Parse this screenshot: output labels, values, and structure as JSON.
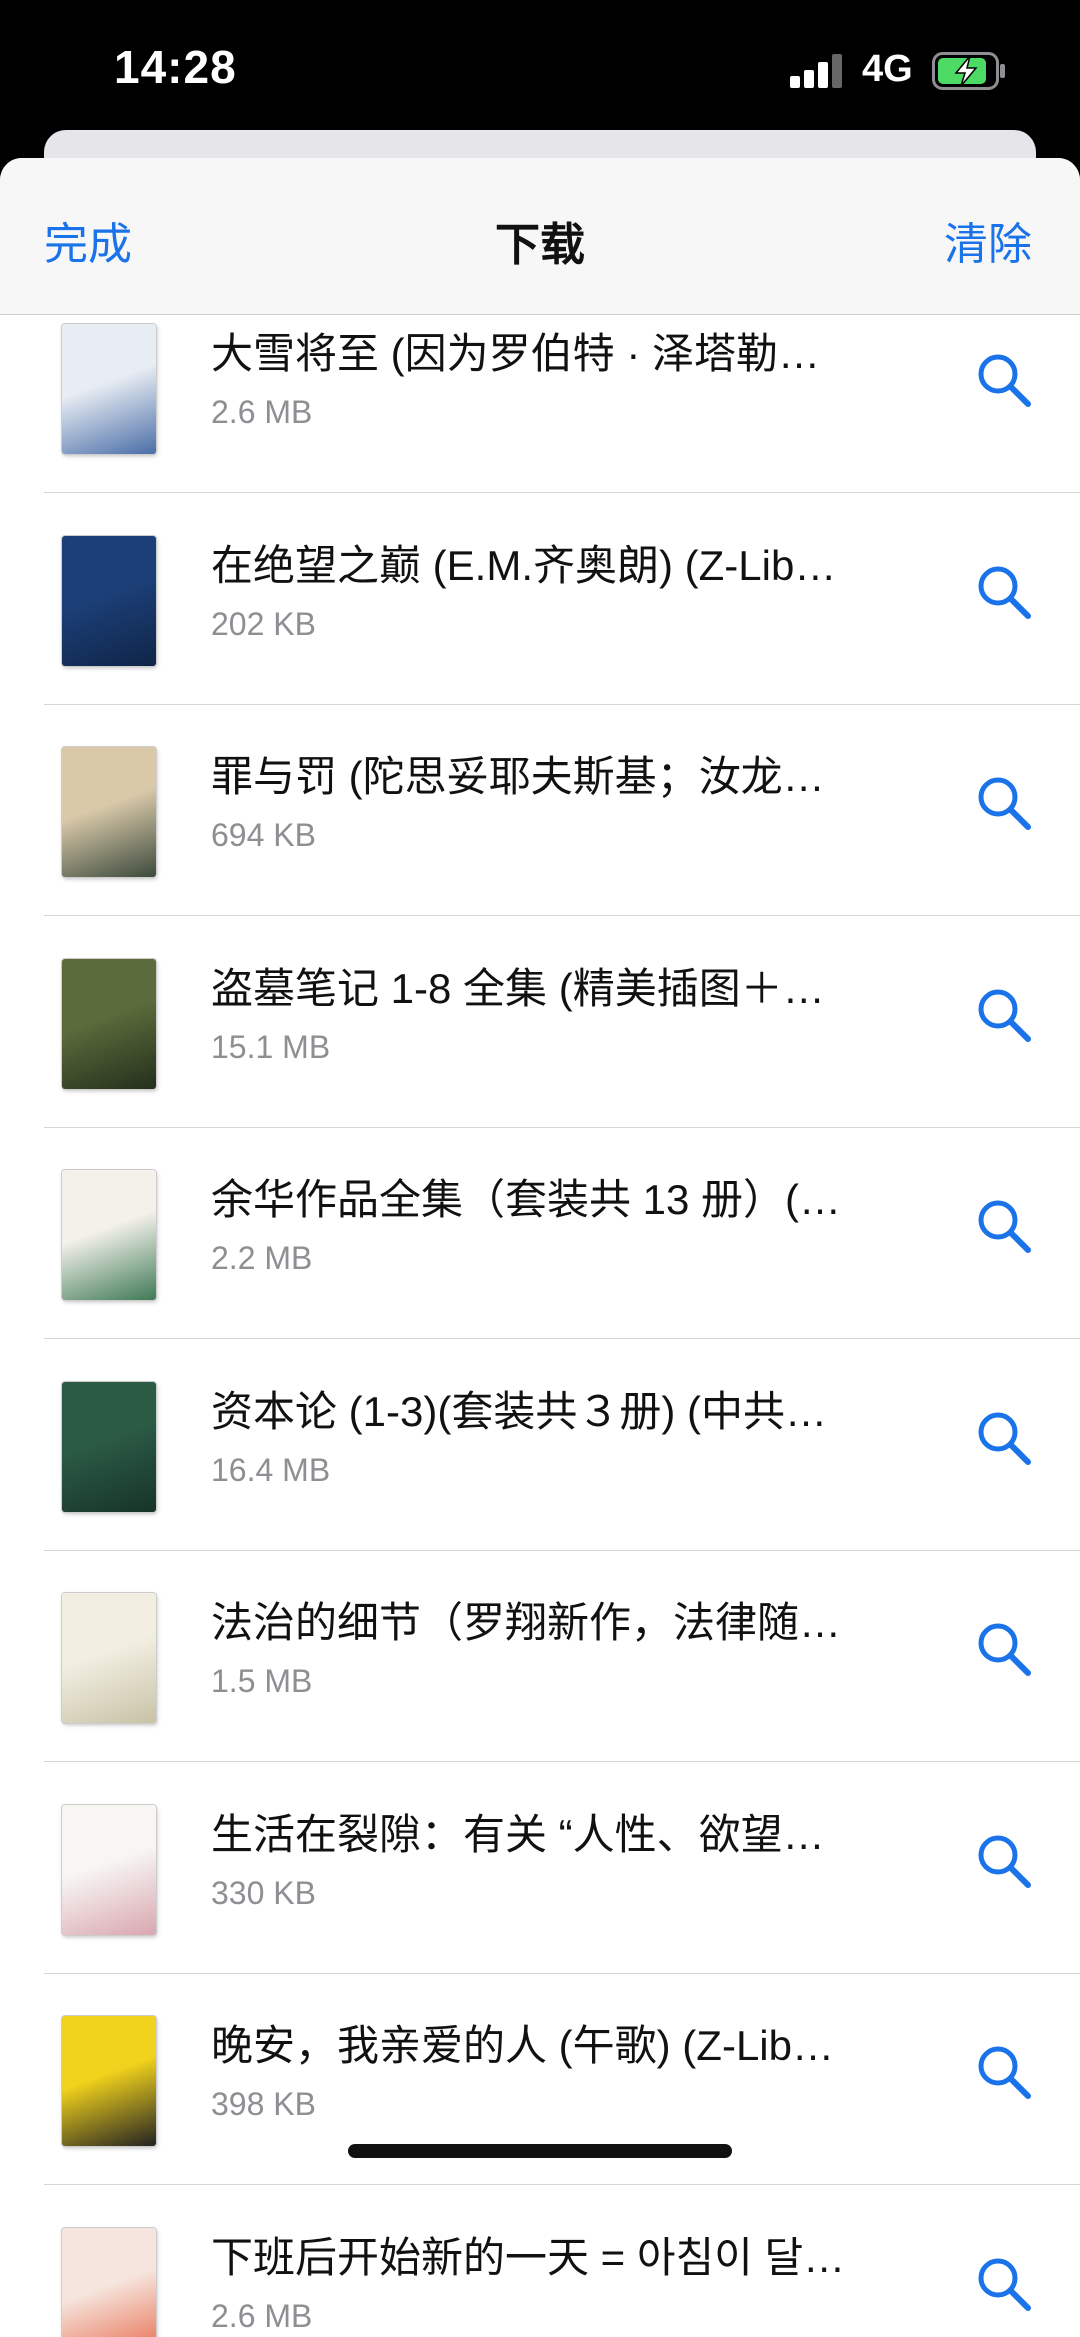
{
  "status": {
    "time": "14:28",
    "network": "4G"
  },
  "nav": {
    "left": "完成",
    "title": "下载",
    "right": "清除"
  },
  "colors": {
    "accent": "#1a73e8"
  },
  "rows": [
    {
      "title": "大雪将至 (因为罗伯特 · 泽塔勒…",
      "size": "2.6 MB",
      "cover": [
        "#e8edf3",
        "#4a6ea8"
      ]
    },
    {
      "title": "在绝望之巅 (E.M.齐奥朗) (Z-Lib…",
      "size": "202 KB",
      "cover": [
        "#1c3f78",
        "#0f2547"
      ]
    },
    {
      "title": "罪与罚 (陀思妥耶夫斯基；汝龙…",
      "size": "694 KB",
      "cover": [
        "#d9c9a9",
        "#3b4a3c"
      ]
    },
    {
      "title": "盗墓笔记 1-8 全集 (精美插图＋…",
      "size": "15.1 MB",
      "cover": [
        "#5b6b3b",
        "#23301c"
      ]
    },
    {
      "title": "余华作品全集（套装共 13 册）(…",
      "size": "2.2 MB",
      "cover": [
        "#f3f1ea",
        "#3f7a56"
      ]
    },
    {
      "title": "资本论 (1-3)(套装共３册) (中共…",
      "size": "16.4 MB",
      "cover": [
        "#2b5a45",
        "#163427"
      ]
    },
    {
      "title": "法治的细节（罗翔新作，法律随…",
      "size": "1.5 MB",
      "cover": [
        "#f2efe2",
        "#c8c2a6"
      ]
    },
    {
      "title": "生活在裂隙：有关 “人性、欲望…",
      "size": "330 KB",
      "cover": [
        "#f7f6f3",
        "#d9a6b0"
      ]
    },
    {
      "title": "晚安，我亲爱的人 (午歌) (Z-Lib…",
      "size": "398 KB",
      "cover": [
        "#f1d21c",
        "#222"
      ]
    },
    {
      "title": "下班后开始新的一天 = 아침이 달…",
      "size": "2.6 MB",
      "cover": [
        "#f6e5de",
        "#e86a4a"
      ]
    }
  ]
}
